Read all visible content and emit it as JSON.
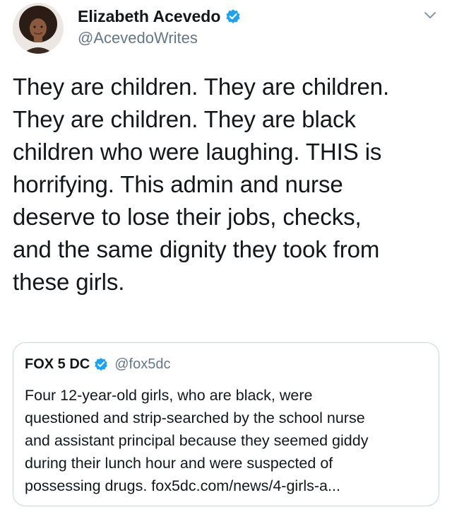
{
  "tweet": {
    "author": {
      "name": "Elizabeth Acevedo",
      "handle": "@AcevedoWrites",
      "verified": true
    },
    "text_lines": [
      "They are children. They are children.",
      "They are children. They are black",
      "children who were laughing. THIS is",
      "horrifying. This admin and nurse",
      "deserve to lose their jobs, checks,",
      "and the same dignity they took from",
      "these girls."
    ],
    "quoted_tweet": {
      "name": "FOX 5 DC",
      "handle": "@fox5dc",
      "verified": true,
      "text_lines": [
        "Four 12-year-old girls, who are black, were",
        "questioned and strip-searched by the school nurse",
        "and assistant principal because they seemed giddy",
        "during their lunch hour and were suspected of",
        "possessing drugs. fox5dc.com/news/4-girls-a..."
      ]
    }
  },
  "icons": {
    "verified": "verified-badge-icon",
    "menu": "chevron-down-icon"
  },
  "colors": {
    "verified_blue": "#1da1f2",
    "secondary_text": "#657786",
    "border": "#ccd6dd"
  }
}
